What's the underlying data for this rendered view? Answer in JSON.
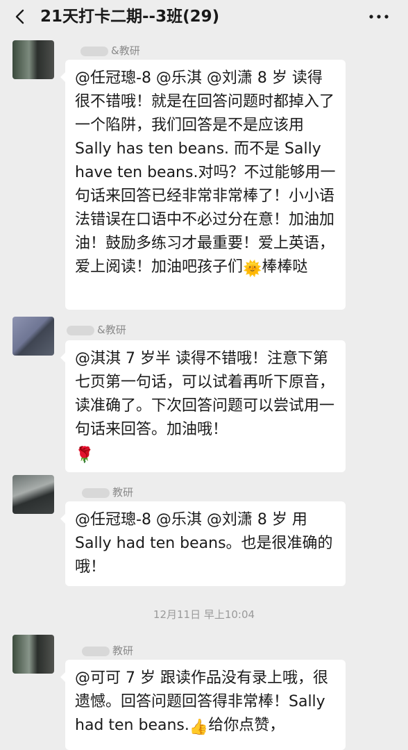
{
  "header": {
    "title": "21天打卡二期--3班(29)"
  },
  "messages": [
    {
      "sender": "&教研",
      "text": "@任冠璁-8 @乐淇 @刘潇 8 岁 读得很不错哦！就是在回答问题时都掉入了一个陷阱，我们回答是不是应该用 Sally has ten beans. 而不是 Sally have ten beans.对吗？不过能够用一句话来回答已经非常非常棒了！小小语法错误在口语中不必过分在意！加油加油！鼓励多练习才最重要！爱上英语，爱上阅读！加油吧孩子们",
      "emoji": "🌞",
      "text_after": "棒棒哒"
    },
    {
      "sender": "&教研",
      "text": "@淇淇 7 岁半 读得不错哦！注意下第七页第一句话，可以试着再听下原音，读准确了。下次回答问题可以尝试用一句话来回答。加油哦！",
      "emoji": "🌹"
    },
    {
      "sender": "教研",
      "text": "@任冠璁-8 @乐淇 @刘潇 8 岁 用 Sally had ten beans。也是很准确的哦！"
    },
    {
      "sender": "教研",
      "text": "@可可 7 岁 跟读作品没有录上哦，很遗憾。回答问题回答得非常棒！Sally had ten beans.",
      "emoji": "👍",
      "text_after": "给你点赞，"
    }
  ],
  "timestamp": "12月11日 早上10:04"
}
